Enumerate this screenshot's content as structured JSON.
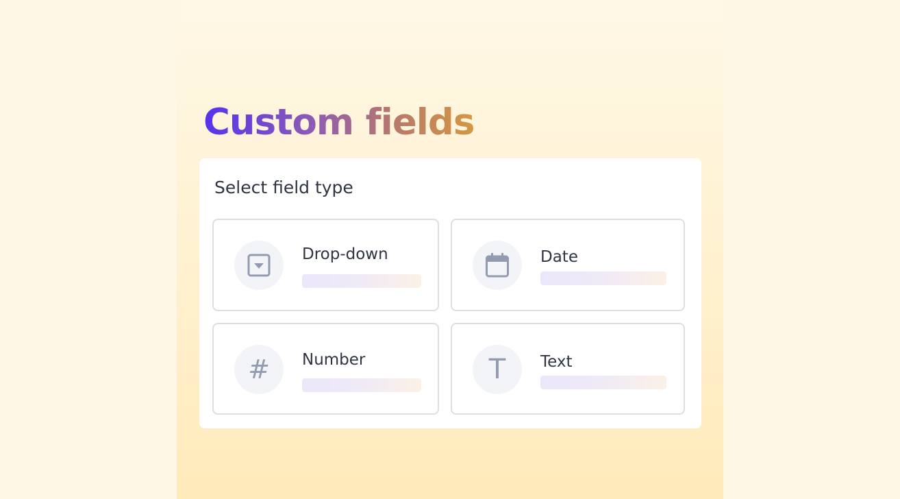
{
  "headline": "Custom fields",
  "panel": {
    "title": "Select field type",
    "options": [
      {
        "label": "Drop-down",
        "icon": "dropdown-icon"
      },
      {
        "label": "Date",
        "icon": "calendar-icon"
      },
      {
        "label": "Number",
        "icon": "hash-icon",
        "glyph": "#"
      },
      {
        "label": "Text",
        "icon": "text-t-icon",
        "glyph": "T"
      }
    ]
  },
  "colors": {
    "background": "#fff7e5",
    "headline_start": "#5533ee",
    "headline_end": "#d49742",
    "icon_gray": "#939bae",
    "border": "#dcdee5"
  }
}
